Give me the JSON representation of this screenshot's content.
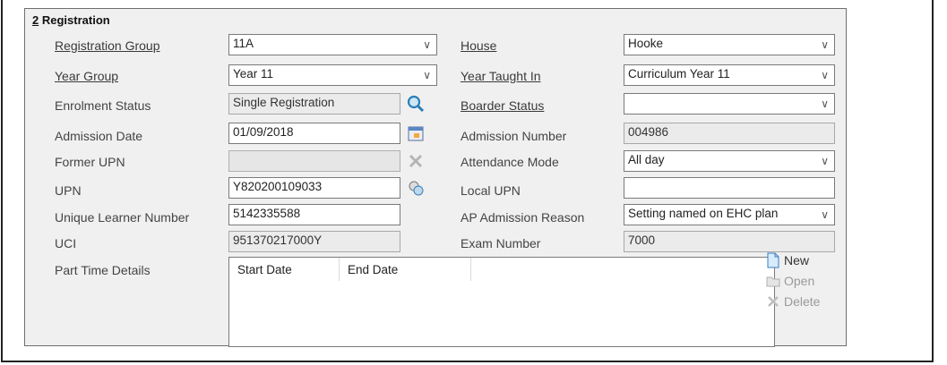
{
  "section": {
    "number": "2",
    "title": "Registration"
  },
  "left": {
    "registration_group": {
      "label": "Registration Group",
      "value": "11A"
    },
    "year_group": {
      "label": "Year Group",
      "value": "Year 11"
    },
    "enrolment_status": {
      "label": "Enrolment Status",
      "value": "Single Registration"
    },
    "admission_date": {
      "label": "Admission Date",
      "value": "01/09/2018"
    },
    "former_upn": {
      "label": "Former UPN",
      "value": ""
    },
    "upn": {
      "label": "UPN",
      "value": "Y820200109033"
    },
    "uln": {
      "label": "Unique Learner Number",
      "value": "5142335588"
    },
    "uci": {
      "label": "UCI",
      "value": "951370217000Y"
    },
    "part_time": {
      "label": "Part Time Details"
    }
  },
  "right": {
    "house": {
      "label": "House",
      "value": "Hooke"
    },
    "year_taught_in": {
      "label": "Year Taught In",
      "value": "Curriculum Year 11"
    },
    "boarder_status": {
      "label": "Boarder Status",
      "value": ""
    },
    "admission_number": {
      "label": "Admission Number",
      "value": "004986"
    },
    "attendance_mode": {
      "label": "Attendance Mode",
      "value": "All day"
    },
    "local_upn": {
      "label": "Local UPN",
      "value": ""
    },
    "ap_admission_reason": {
      "label": "AP Admission Reason",
      "value": "Setting named on EHC plan"
    },
    "exam_number": {
      "label": "Exam Number",
      "value": "7000"
    }
  },
  "grid": {
    "columns": [
      "Start Date",
      "End Date"
    ]
  },
  "actions": {
    "new": "New",
    "open": "Open",
    "delete": "Delete"
  },
  "icons": {
    "dropdown": "chevron-down-icon",
    "search": "magnifier-icon",
    "calendar": "calendar-icon"
  }
}
